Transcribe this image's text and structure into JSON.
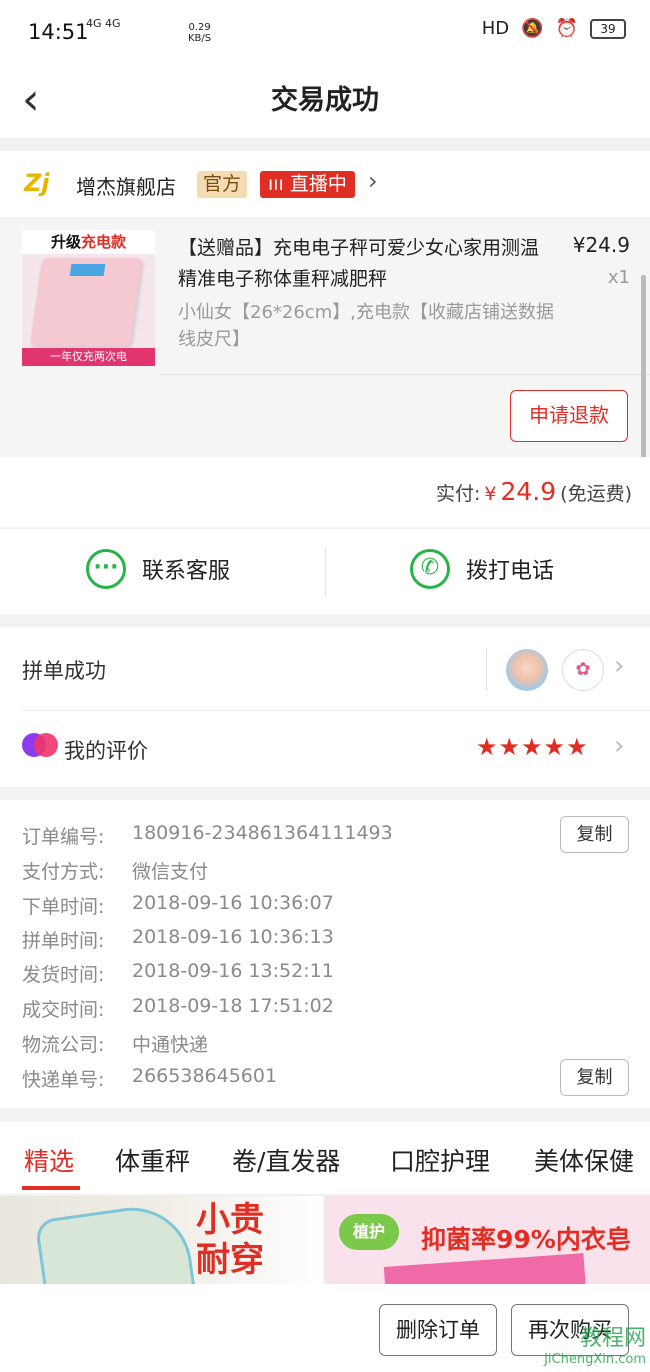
{
  "status_bar": {
    "time": "14:51",
    "network": "4G 4G",
    "speed": "0.29\nKB/S",
    "right_label": "HD",
    "battery": "39"
  },
  "header": {
    "title": "交易成功",
    "back_icon": "chevron-left-icon"
  },
  "shop": {
    "logo_text": "Zj",
    "name": "增杰旗舰店",
    "badge_official": "官方",
    "badge_live": "直播中"
  },
  "product": {
    "thumb_top_prefix": "升级",
    "thumb_top_highlight": "充电款",
    "thumb_bottom": "一年仅充两次电",
    "title": "【送赠品】充电电子秤可爱少女心家用测温精准电子称体重秤减肥秤",
    "price": "¥24.9",
    "qty": "x1",
    "sku": "小仙女【26*26cm】,充电款【收藏店铺送数据线皮尺】",
    "refund_label": "申请退款"
  },
  "payment": {
    "label": "实付:",
    "currency": "¥",
    "amount": "24.9",
    "note": "(免运费)"
  },
  "contact": {
    "service_label": "联系客服",
    "phone_label": "拨打电话"
  },
  "group": {
    "label": "拼单成功"
  },
  "rating": {
    "label": "我的评价",
    "stars": 5
  },
  "order_info": {
    "rows": [
      {
        "key": "订单编号:",
        "value": "180916-234861364111493"
      },
      {
        "key": "支付方式:",
        "value": "微信支付"
      },
      {
        "key": "下单时间:",
        "value": "2018-09-16 10:36:07"
      },
      {
        "key": "拼单时间:",
        "value": "2018-09-16 10:36:13"
      },
      {
        "key": "发货时间:",
        "value": "2018-09-16 13:52:11"
      },
      {
        "key": "成交时间:",
        "value": "2018-09-18 17:51:02"
      },
      {
        "key": "物流公司:",
        "value": "中通快递"
      },
      {
        "key": "快递单号:",
        "value": "266538645601"
      }
    ],
    "copy_label": "复制"
  },
  "tabs": [
    "精选",
    "体重秤",
    "卷/直发器",
    "口腔护理",
    "美体保健"
  ],
  "banners": {
    "left_text_1": "小贵",
    "left_text_2": "耐穿",
    "right_logo": "植护",
    "right_text": "抑菌率99%内衣皂"
  },
  "bottom_actions": {
    "delete_label": "删除订单",
    "rebuy_label": "再次购买"
  },
  "watermark": {
    "line1": "教程网",
    "line2": "JiChengXin.com"
  },
  "colors": {
    "accent": "#e02e24",
    "green": "#28b445"
  }
}
